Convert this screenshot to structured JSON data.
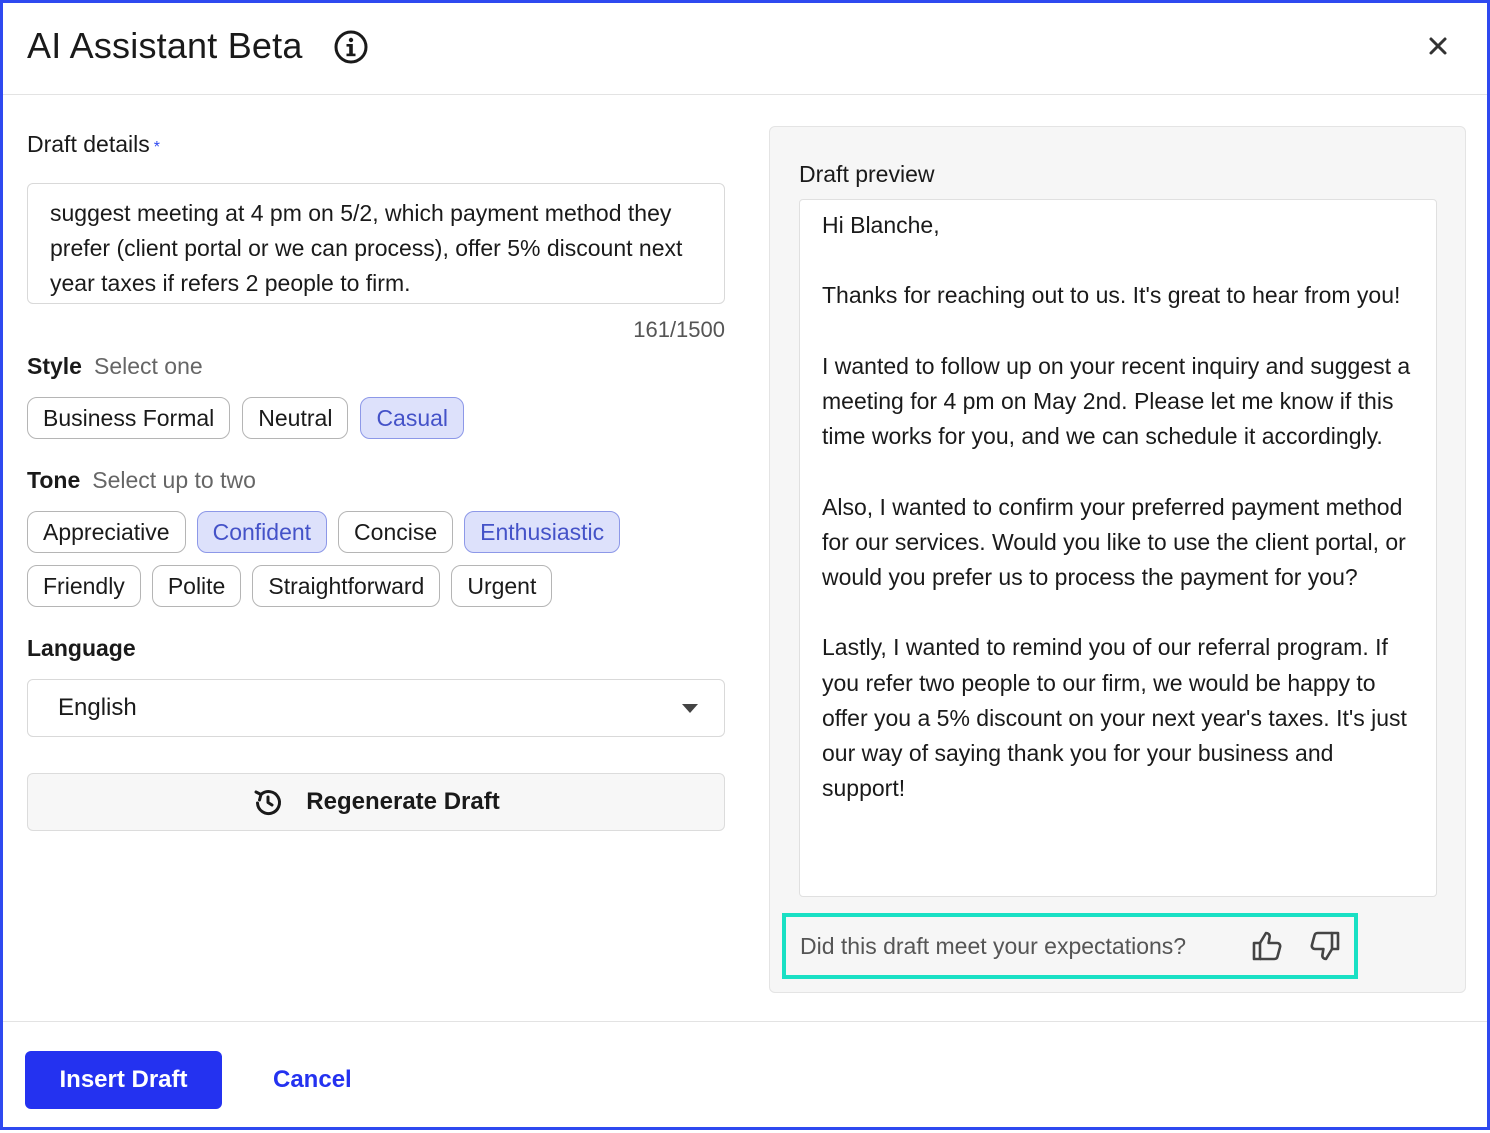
{
  "header": {
    "title": "AI Assistant Beta",
    "info_icon": "info-circle-icon",
    "close_icon": "close-icon"
  },
  "draft_details": {
    "label": "Draft details",
    "required_mark": "*",
    "text": "suggest meeting at 4 pm on 5/2, which payment method they prefer (client portal or we can process), offer 5% discount next year taxes if refers 2 people to firm.",
    "counter": "161/1500"
  },
  "style": {
    "label": "Style",
    "hint": "Select one",
    "options": [
      {
        "label": "Business Formal",
        "selected": false
      },
      {
        "label": "Neutral",
        "selected": false
      },
      {
        "label": "Casual",
        "selected": true
      }
    ]
  },
  "tone": {
    "label": "Tone",
    "hint": "Select up to two",
    "options_row1": [
      {
        "label": "Appreciative",
        "selected": false
      },
      {
        "label": "Confident",
        "selected": true
      },
      {
        "label": "Concise",
        "selected": false
      },
      {
        "label": "Enthusiastic",
        "selected": true
      }
    ],
    "options_row2": [
      {
        "label": "Friendly",
        "selected": false
      },
      {
        "label": "Polite",
        "selected": false
      },
      {
        "label": "Straightforward",
        "selected": false
      },
      {
        "label": "Urgent",
        "selected": false
      }
    ]
  },
  "language": {
    "label": "Language",
    "selected": "English"
  },
  "regenerate": {
    "label": "Regenerate Draft",
    "icon": "refresh-icon"
  },
  "preview": {
    "label": "Draft preview",
    "paragraphs": [
      "Hi Blanche,",
      "Thanks for reaching out to us. It's great to hear from you!",
      "I wanted to follow up on your recent inquiry and suggest a meeting for 4 pm on May 2nd. Please let me know if this time works for you, and we can schedule it accordingly.",
      "Also, I wanted to confirm your preferred payment method for our services. Would you like to use the client portal, or would you prefer us to process the payment for you?",
      "Lastly, I wanted to remind you of our referral program. If you refer two people to our firm, we would be happy to offer you a 5% discount on your next year's taxes. It's just our way of saying thank you for your business and support!"
    ]
  },
  "feedback": {
    "question": "Did this draft meet your expectations?",
    "thumbs_up_icon": "thumbs-up-icon",
    "thumbs_down_icon": "thumbs-down-icon",
    "highlight_color": "#19e0c4"
  },
  "footer": {
    "insert_label": "Insert Draft",
    "cancel_label": "Cancel"
  },
  "colors": {
    "accent": "#2432f0",
    "dialog_border": "#2f49f0",
    "chip_selected_bg": "#dde1fb",
    "chip_selected_text": "#4452c8"
  }
}
